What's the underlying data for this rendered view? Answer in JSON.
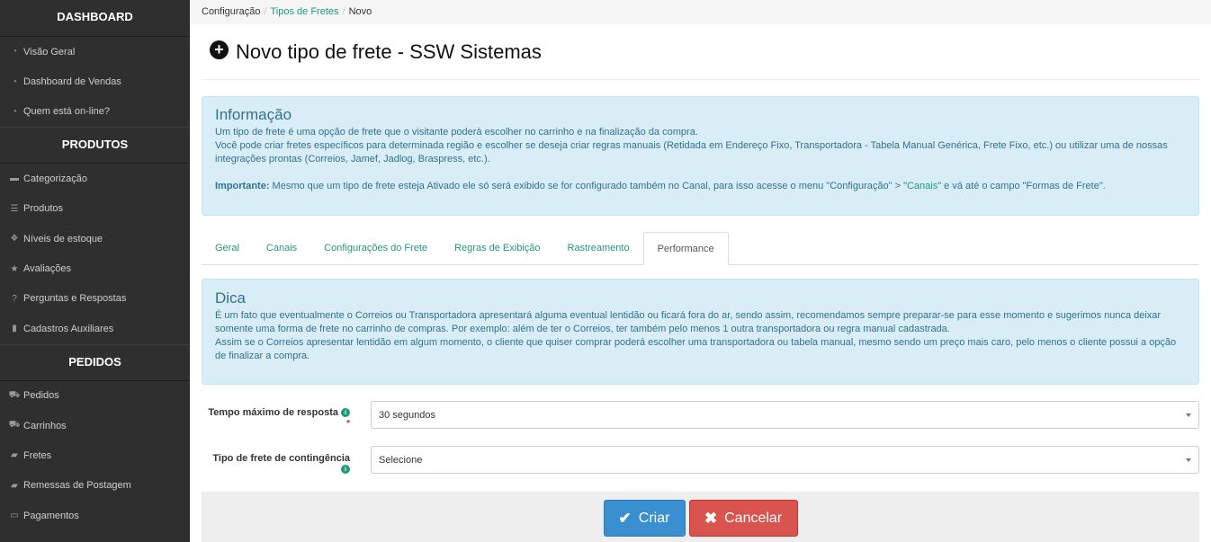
{
  "sidebar": {
    "sections": [
      {
        "title": "DASHBOARD",
        "items": [
          {
            "label": "Visão Geral",
            "icon": "dashboard-icon"
          },
          {
            "label": "Dashboard de Vendas",
            "icon": "dashboard-icon"
          },
          {
            "label": "Quem está on-line?",
            "icon": "dashboard-icon"
          }
        ]
      },
      {
        "title": "PRODUTOS",
        "items": [
          {
            "label": "Categorização",
            "icon": "folder-icon"
          },
          {
            "label": "Produtos",
            "icon": "list-icon"
          },
          {
            "label": "Níveis de estoque",
            "icon": "cubes-icon"
          },
          {
            "label": "Avaliações",
            "icon": "star-icon"
          },
          {
            "label": "Perguntas e Respostas",
            "icon": "question-icon"
          },
          {
            "label": "Cadastros Auxiliares",
            "icon": "file-icon"
          }
        ]
      },
      {
        "title": "PEDIDOS",
        "items": [
          {
            "label": "Pedidos",
            "icon": "cart-icon"
          },
          {
            "label": "Carrinhos",
            "icon": "cart-icon"
          },
          {
            "label": "Fretes",
            "icon": "truck-icon"
          },
          {
            "label": "Remessas de Postagem",
            "icon": "truck-icon"
          },
          {
            "label": "Pagamentos",
            "icon": "card-icon"
          }
        ]
      }
    ]
  },
  "breadcrumb": {
    "items": [
      "Configuração",
      "Tipos de Fretes",
      "Novo"
    ]
  },
  "page": {
    "title": "Novo tipo de frete - SSW Sistemas"
  },
  "info_alert": {
    "title": "Informação",
    "line1": "Um tipo de frete é uma opção de frete que o visitante poderá escolher no carrinho e na finalização da compra.",
    "line2": "Você pode criar fretes específicos para determinada região e escolher se deseja criar regras manuais (Retidada em Endereço Fixo, Transportadora - Tabela Manual Genérica, Frete Fixo, etc.) ou utilizar uma de nossas integrações prontas (Correios, Jamef, Jadlog, Braspress, etc.).",
    "important_label": "Importante:",
    "important_text1": " Mesmo que um tipo de frete esteja Ativado ele só será exibido se for configurado também no Canal, para isso acesse o menu \"Configuração\" > \"",
    "important_link": "Canais",
    "important_text2": "\" e vá até o campo \"Formas de Frete\"."
  },
  "tabs": [
    "Geral",
    "Canais",
    "Configurações do Frete",
    "Regras de Exibição",
    "Rastreamento",
    "Performance"
  ],
  "tip_alert": {
    "title": "Dica",
    "line1": "É um fato que eventualmente o Correios ou Transportadora apresentará alguma eventual lentidão ou ficará fora do ar, sendo assim, recomendamos sempre preparar-se para esse momento e sugerimos nunca deixar somente uma forma de frete no carrinho de compras. Por exemplo: além de ter o Correios, ter também pelo menos 1 outra transportadora ou regra manual cadastrada.",
    "line2": "Assim se o Correios apresentar lentidão em algum momento, o cliente que quiser comprar poderá escolher uma transportadora ou tabela manual, mesmo sendo um preço mais caro, pelo menos o cliente possui a opção de finalizar a compra."
  },
  "form": {
    "timeout_label": "Tempo máximo de resposta",
    "timeout_value": "30 segundos",
    "required_mark": "*",
    "fallback_label": "Tipo de frete de contingência",
    "fallback_value": "Selecione"
  },
  "actions": {
    "create": "Criar",
    "cancel": "Cancelar"
  },
  "colors": {
    "sidebar_bg": "#2f2f2f",
    "accent": "#1f9a7a",
    "primary": "#3a8fd0",
    "danger": "#d9534f",
    "info_bg": "#d9edf7"
  }
}
